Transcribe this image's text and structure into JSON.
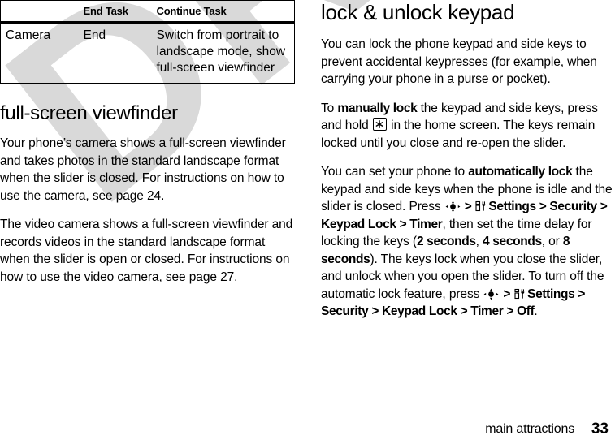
{
  "document": {
    "watermark": "DRAFT",
    "footer": {
      "section_title": "main attractions",
      "page_number": "33"
    }
  },
  "left_column": {
    "table": {
      "headers": [
        "",
        "End Task",
        "Continue Task"
      ],
      "rows": [
        {
          "feature": "Camera",
          "end_task": "End",
          "continue_task": "Switch from portrait to landscape mode, show full-screen viewfinder"
        }
      ]
    },
    "heading": "full-screen viewfinder",
    "paragraphs": [
      "Your phone’s camera shows a full-screen viewfinder and takes photos in the standard landscape format when the slider is closed. For instructions on how to use the camera, see page 24.",
      "The video camera shows a full-screen viewfinder and records videos in the standard landscape format when the slider is open or closed. For instructions on how to use the video camera, see page 27."
    ]
  },
  "right_column": {
    "heading": "lock & unlock keypad",
    "paragraph_1": "You can lock the phone keypad and side keys to prevent accidental keypresses (for example, when carrying your phone in a purse or pocket).",
    "paragraph_2": {
      "lead": "To ",
      "bold_1": "manually lock",
      "mid_1": " the keypad and side keys, press and hold ",
      "key_glyph": "star-key",
      "mid_2": " in the home screen. The keys remain locked until you close and re-open the slider."
    },
    "paragraph_3": {
      "lead": "You can set your phone to ",
      "bold_1": "automatically lock",
      "mid_1": " the keypad and side keys when the phone is idle and the slider is closed. Press ",
      "nav_glyph": "center-select-key",
      "sep_1": " > ",
      "settings_icon": "settings-tools-icon",
      "path_1": "Settings",
      "sep_2": " > ",
      "path_2": "Security",
      "sep_3": " > ",
      "path_3": "Keypad Lock",
      "sep_4": " > ",
      "path_4": "Timer",
      "mid_2": ", then set the time delay for locking the keys (",
      "opt_1": "2 seconds",
      "opt_sep_1": ", ",
      "opt_2": "4 seconds",
      "opt_sep_2": ", or ",
      "opt_3": "8 seconds",
      "mid_3": "). The keys lock when you close the slider, and unlock when you open the slider. To turn off the automatic lock feature, press ",
      "nav_glyph_2": "center-select-key",
      "sep_5": " > ",
      "settings_icon_2": "settings-tools-icon",
      "path2_1": "Settings",
      "sep_6": " > ",
      "path2_2": "Security",
      "sep_7": " > ",
      "path2_3": "Keypad Lock",
      "sep_8": " > ",
      "path2_4": "Timer",
      "sep_9": " > ",
      "path2_5": "Off",
      "tail": "."
    }
  },
  "colors": {
    "text": "#000000",
    "background": "#ffffff",
    "watermark": "#d9d9d9",
    "rule": "#000000"
  }
}
